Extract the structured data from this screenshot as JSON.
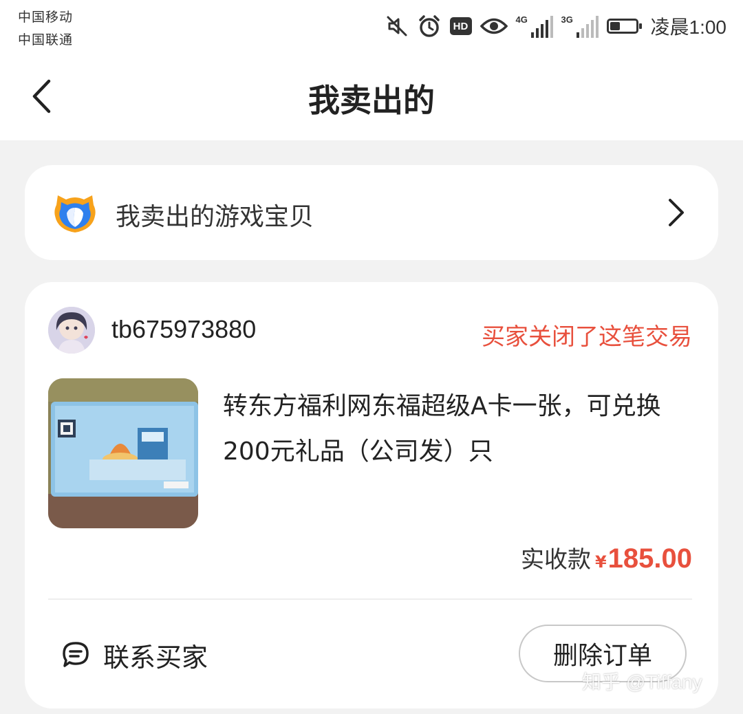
{
  "status_bar": {
    "carrier_1": "中国移动",
    "carrier_2": "中国联通",
    "hd_badge": "HD",
    "network_1": "4G",
    "network_2": "3G",
    "time": "凌晨1:00",
    "icons": [
      "mute-icon",
      "alarm-icon",
      "hd-icon",
      "eye-icon",
      "signal-4g-icon",
      "signal-3g-icon",
      "battery-icon"
    ]
  },
  "header": {
    "title": "我卖出的"
  },
  "game_section": {
    "label": "我卖出的游戏宝贝"
  },
  "order": {
    "buyer_name": "tb675973880",
    "status": "买家关闭了这笔交易",
    "product_title": "转东方福利网东福超级A卡一张，可兑换200元礼品（公司发）只",
    "price_label": "实收款",
    "currency": "¥",
    "price": "185.00",
    "contact_label": "联系买家",
    "delete_label": "删除订单"
  },
  "watermark": "知乎 @Tiffany",
  "colors": {
    "accent_red": "#e8503d",
    "page_bg": "#f2f2f2",
    "card_bg": "#ffffff",
    "logo_blue": "#2f80ed",
    "logo_orange": "#f7a21b"
  }
}
